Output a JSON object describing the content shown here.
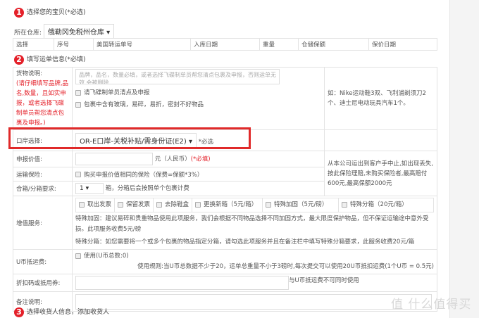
{
  "section1": {
    "num": "1",
    "title": "选择您的宝贝(*必选)"
  },
  "warehouse": {
    "label": "所在仓库:",
    "value": "俄勒冈免税州仓库"
  },
  "items_table": {
    "headers": [
      "选择",
      "序号",
      "美国转运单号",
      "入库日期",
      "重量",
      "仓储保额",
      "保价日期"
    ]
  },
  "section2": {
    "num": "2",
    "title": "填写运单信息(*必填)"
  },
  "goods": {
    "label": "货物说明:",
    "hint": "(请仔细填写品牌,品名,数量，且如实申报，或者选择飞碟制单员帮您清点包裹及申报。)",
    "placeholder": "品牌，品名，数量必填，或者选择飞碟制单员帮您清点包裹及申报，否则运单无效,会被删除",
    "check1": "请飞碟制单员清点及申报",
    "check2": "包裹中含有玻璃，易碎，易折，密封不好物品",
    "example": "如：Nike运动鞋3双、飞利浦剃须刀2个、迪士尼电动玩具汽车1个。"
  },
  "port": {
    "label": "口岸选择:",
    "value": "OR-E口岸-关税补贴/需身份证(E2)",
    "required": "*必选"
  },
  "declared": {
    "label": "申报价值:",
    "unit": "元（人民币）",
    "required": "(*必填)"
  },
  "insurance": {
    "label": "运输保险:",
    "check": "购买申报价值相同的保险（保费=保额*3%）",
    "note": "从本公司运出到客户手中止,如出现丢失,按此保险理赔,未购买保险者,最高赔付600元,最高保额2000元"
  },
  "split": {
    "label": "合箱/分箱要求:",
    "value": "1",
    "text": "箱，分箱后会按照单个包裹计费"
  },
  "services": {
    "label": "增值服务:",
    "options": [
      "取出发票",
      "保留发票",
      "去除鞋盒",
      "更换新箱（5元/箱）",
      "特殊加固（5元/磅）",
      "特殊分箱（20元/箱）"
    ],
    "desc1": "特殊加固：建议易碎和贵重物品使用此项服务，我们会根据不同物品选择不同加固方式，最大限度保护物品，但不保证运输途中意外受损。此项服务收费5元/磅",
    "desc2": "特殊分箱：如您需要将一个或多个包裹的物品指定分箱，请勾选此项服务并且在备注栏中填写特殊分箱要求，此服务收费20元/箱"
  },
  "ucoin": {
    "label": "U币抵运费:",
    "check": "使用(U币总数:0)",
    "rule": "使用规则:当U币总数据不少于20，运单总重量不小于3磅时,每次提交可以使用20U币抵扣运费(1个U币 = 0.5元)"
  },
  "discount": {
    "label": "折扣码或抵用券:",
    "note": "与U币抵运费不可同时使用"
  },
  "remark": {
    "label": "备注说明:"
  },
  "section3": {
    "num": "3",
    "title": "选择收货人信息，添加收货人"
  },
  "watermark": "值 什么值得买"
}
